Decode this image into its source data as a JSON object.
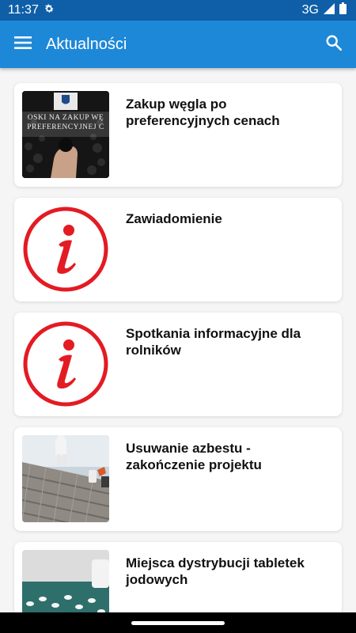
{
  "status": {
    "time": "11:37",
    "network": "3G"
  },
  "app_bar": {
    "title": "Aktualności"
  },
  "news": [
    {
      "title": "Zakup węgla po preferencyjnych cenach",
      "thumb_text": "OSKI NA ZAKUP WĘ PREFERENCYJNEJ C"
    },
    {
      "title": "Zawiadomienie"
    },
    {
      "title": "Spotkania informacyjne dla rolników"
    },
    {
      "title": "Usuwanie azbestu - zakończenie projektu"
    },
    {
      "title": "Miejsca dystrybucji tabletek jodowych"
    }
  ],
  "colors": {
    "status_bar": "#0f5fa8",
    "app_bar": "#1e88d8",
    "info_red": "#e31b23"
  }
}
